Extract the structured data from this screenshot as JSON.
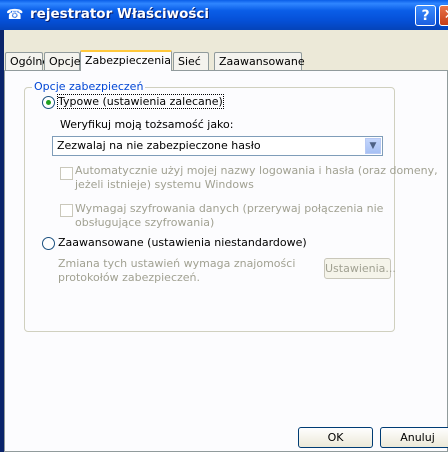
{
  "window": {
    "title": "rejestrator Właściwości"
  },
  "titlebar": {
    "help": "?",
    "close": "✕"
  },
  "tabs": [
    {
      "label": "Ogólne"
    },
    {
      "label": "Opcje"
    },
    {
      "label": "Zabezpieczenia"
    },
    {
      "label": "Sieć"
    },
    {
      "label": "Zaawansowane"
    }
  ],
  "security": {
    "group_label": "Opcje zabezpieczeń",
    "typical": {
      "label": "Typowe (ustawienia zalecane)",
      "checked": true
    },
    "verify_label": "Weryfikuj moją tożsamość jako:",
    "verify_select": {
      "value": "Zezwalaj na nie zabezpieczone hasło"
    },
    "auto_logon": {
      "line1": "Automatycznie użyj mojej nazwy logowania i hasła (oraz domeny,",
      "line2": "jeżeli istnieje) systemu Windows"
    },
    "require_encryption": {
      "line1": "Wymagaj szyfrowania danych (przerywaj połączenia nie",
      "line2": "obsługujące szyfrowania)"
    },
    "advanced": {
      "label": "Zaawansowane (ustawienia niestandardowe)",
      "checked": false
    },
    "advanced_note": {
      "line1": "Zmiana tych ustawień wymaga znajomości",
      "line2": "protokołów zabezpieczeń."
    },
    "settings_button": "Ustawienia..."
  },
  "footer": {
    "ok": "OK",
    "cancel": "Anuluj"
  }
}
